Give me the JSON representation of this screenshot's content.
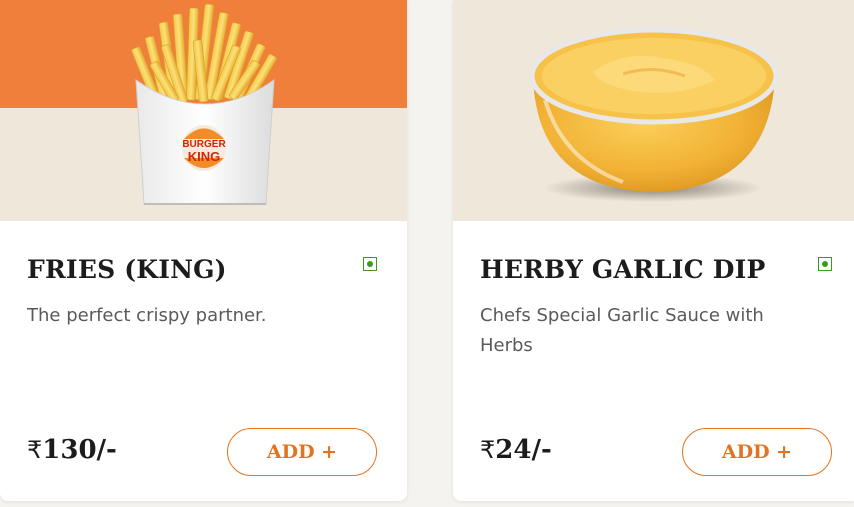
{
  "items": [
    {
      "title": "FRIES (KING)",
      "description": "The perfect crispy partner.",
      "currency": "₹",
      "price": "130/-",
      "add_label": "ADD +",
      "brand_text": [
        "BURGER",
        "KING"
      ]
    },
    {
      "title": "HERBY GARLIC DIP",
      "description": "Chefs Special Garlic Sauce with Herbs",
      "currency": "₹",
      "price": "24/-",
      "add_label": "ADD +"
    }
  ],
  "colors": {
    "accent": "#e27420",
    "veg_green": "#3e9a1a",
    "banner_orange": "#ef7f3b",
    "image_bg": "#efe7da"
  }
}
